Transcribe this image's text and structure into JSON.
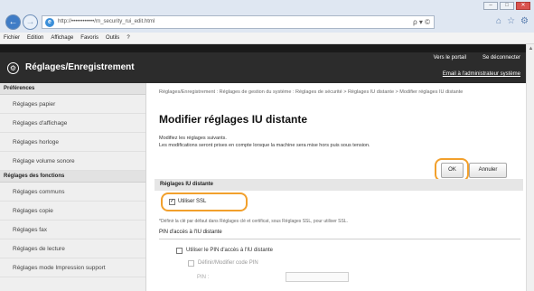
{
  "browser": {
    "url": "http://••••••••••••/rn_security_rui_edit.html",
    "url_actions": "ρ ▾ ©",
    "window_buttons": [
      "–",
      "□",
      "✕"
    ],
    "menu": [
      "Fichier",
      "Edition",
      "Affichage",
      "Favoris",
      "Outils",
      "?"
    ]
  },
  "header": {
    "title": "Réglages/Enregistrement",
    "portal_link": "Vers le portail",
    "logout_link": "Se déconnecter",
    "admin_mail": "Email à l'administrateur système"
  },
  "sidebar": {
    "section1": "Préférences",
    "items1": [
      "Réglages papier",
      "Réglages d'affichage",
      "Réglages horloge",
      "Réglage volume sonore"
    ],
    "section2": "Réglages des fonctions",
    "items2": [
      "Réglages communs",
      "Réglages copie",
      "Réglages fax",
      "Réglages de lecture",
      "Réglages mode Impression support"
    ]
  },
  "main": {
    "breadcrumb": "Réglages/Enregistrement : Réglages de gestion du système : Réglages de sécurité > Réglages IU distante > Modifier réglages IU distante",
    "title": "Modifier réglages IU distante",
    "desc1": "Modifiez les réglages suivants.",
    "desc2": "Les modifications seront prises en compte lorsque la machine sera mise hors puis sous tension.",
    "ok_label": "OK",
    "cancel_label": "Annuler",
    "section_title": "Réglages IU distante",
    "ssl_label": "Utiliser SSL",
    "ssl_checked": "✓",
    "note": "*Définir la clé par défaut dans Réglages clé et certificat, sous Réglages SSL, pour utiliser SSL.",
    "pin_section": "PIN d'accès à l'IU distante",
    "pin_label": "Utiliser le PIN d'accès à l'IU distante",
    "set_pin_label": "Définir/Modifier code PIN",
    "pin_field_label": "PIN :"
  }
}
